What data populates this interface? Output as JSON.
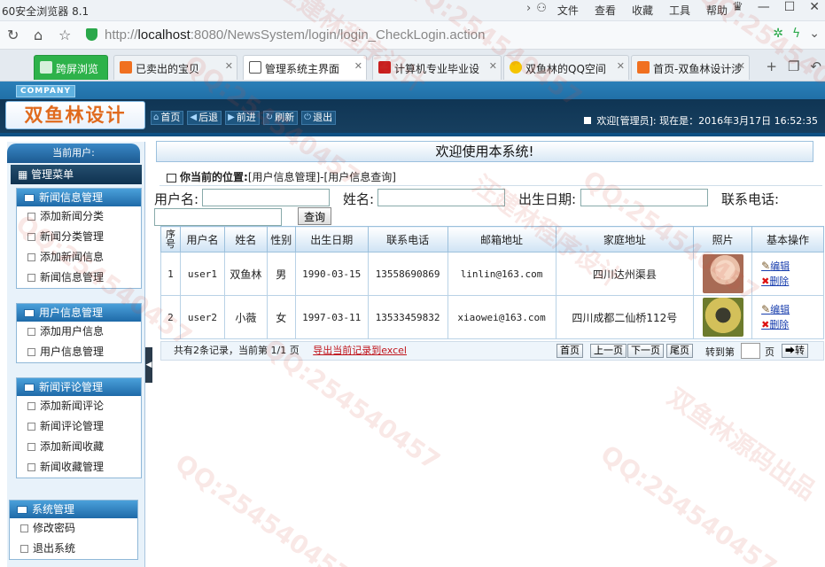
{
  "browser": {
    "window_title": "60安全浏览器 8.1",
    "menus": [
      "文件",
      "查看",
      "收藏",
      "工具",
      "帮助"
    ],
    "url_scheme": "http://",
    "url_host": "localhost",
    "url_rest": ":8080/NewsSystem/login/login_CheckLogin.action",
    "tabs": [
      {
        "label": "跨屏浏览",
        "style": "green"
      },
      {
        "label": "已卖出的宝贝",
        "style": "normal"
      },
      {
        "label": "管理系统主界面",
        "style": "active"
      },
      {
        "label": "计算机专业毕业设",
        "style": "normal"
      },
      {
        "label": "双鱼林的QQ空间",
        "style": "normal"
      },
      {
        "label": "首页-双鱼林设计涉",
        "style": "normal"
      }
    ],
    "new_tab": "+"
  },
  "header": {
    "company": "COMPANY",
    "logo": "双鱼林设计",
    "nav": [
      "首页",
      "后退",
      "前进",
      "刷新",
      "退出"
    ],
    "welcome": "欢迎[管理员]:    现在是：2016年3月17日  16:52:35"
  },
  "sidebar": {
    "current_user": "当前用户:",
    "menu_title": "管理菜单",
    "groups": [
      {
        "title": "新闻信息管理",
        "items": [
          "添加新闻分类",
          "新闻分类管理",
          "添加新闻信息",
          "新闻信息管理"
        ]
      },
      {
        "title": "用户信息管理",
        "items": [
          "添加用户信息",
          "用户信息管理"
        ]
      },
      {
        "title": "新闻评论管理",
        "items": [
          "添加新闻评论",
          "新闻评论管理",
          "添加新闻收藏",
          "新闻收藏管理"
        ]
      },
      {
        "title": "系统管理",
        "items": [
          "修改密码",
          "退出系统"
        ]
      }
    ]
  },
  "main": {
    "title": "欢迎使用本系统!",
    "location_label": "你当前的位置:",
    "location_path": "[用户信息管理]-[用户信息查询]",
    "search": {
      "username_label": "用户名:",
      "name_label": "姓名:",
      "birthday_label": "出生日期:",
      "phone_label": "联系电话:",
      "button": "查询"
    },
    "table": {
      "headers": [
        "序号",
        "用户名",
        "姓名",
        "性别",
        "出生日期",
        "联系电话",
        "邮箱地址",
        "家庭地址",
        "照片",
        "基本操作"
      ],
      "rows": [
        [
          "1",
          "user1",
          "双鱼林",
          "男",
          "1990-03-15",
          "13558690869",
          "linlin@163.com",
          "四川达州渠县"
        ],
        [
          "2",
          "user2",
          "小薇",
          "女",
          "1997-03-11",
          "13533459832",
          "xiaowei@163.com",
          "四川成都二仙桥112号"
        ]
      ],
      "edit_label": "编辑",
      "delete_label": "删除"
    },
    "footer": {
      "summary": "共有2条记录，当前第 1/1 页",
      "export": "导出当前记录到excel",
      "first": "首页",
      "prev": "上一页",
      "next": "下一页",
      "last": "尾页",
      "goto_label": "转到第",
      "page_unit": "页",
      "go": "➡转"
    }
  },
  "watermark": [
    "QQ:254540457",
    "汪建林程序设计",
    "双鱼林源码出品"
  ]
}
